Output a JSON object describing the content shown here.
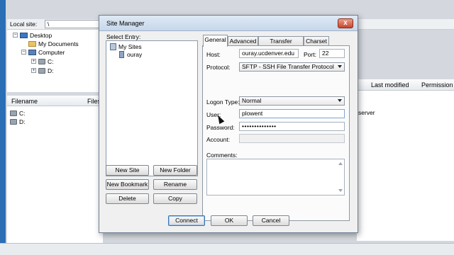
{
  "background": {
    "local_site_label": "Local site:",
    "local_site_value": "\\",
    "tree": [
      {
        "label": "Desktop",
        "icon": "desktop-icon"
      },
      {
        "label": "My Documents",
        "icon": "folder-icon"
      },
      {
        "label": "Computer",
        "icon": "computer-icon"
      },
      {
        "label": "C:",
        "icon": "drive-icon"
      },
      {
        "label": "D:",
        "icon": "drive-icon"
      }
    ],
    "list_headers": [
      "Filename",
      "Files"
    ],
    "list_items": [
      "C:",
      "D:"
    ],
    "right_headers": [
      "Last modified",
      "Permission"
    ],
    "right_text": "server"
  },
  "dialog": {
    "title": "Site Manager",
    "close_glyph": "x",
    "select_entry_label": "Select Entry:",
    "tree": {
      "root": "My Sites",
      "child": "ouray"
    },
    "buttons": {
      "new_site": "New Site",
      "new_folder": "New Folder",
      "new_bookmark": "New Bookmark",
      "rename": "Rename",
      "delete": "Delete",
      "copy": "Copy",
      "connect": "Connect",
      "ok": "OK",
      "cancel": "Cancel"
    },
    "tabs": [
      "General",
      "Advanced",
      "Transfer Settings",
      "Charset"
    ],
    "active_tab": "General",
    "general": {
      "host_label": "Host:",
      "host_value": "ouray.ucdenver.edu",
      "port_label": "Port:",
      "port_value": "22",
      "protocol_label": "Protocol:",
      "protocol_value": "SFTP - SSH File Transfer Protocol",
      "logon_label": "Logon Type:",
      "logon_value": "Normal",
      "user_label": "User:",
      "user_value": "plowent",
      "password_label": "Password:",
      "password_value": "••••••••••••••",
      "account_label": "Account:",
      "account_value": "",
      "comments_label": "Comments:"
    }
  },
  "colors": {
    "accent": "#3a75b9",
    "close_button": "#c9452a",
    "titlebar": "#c7d7ea"
  }
}
